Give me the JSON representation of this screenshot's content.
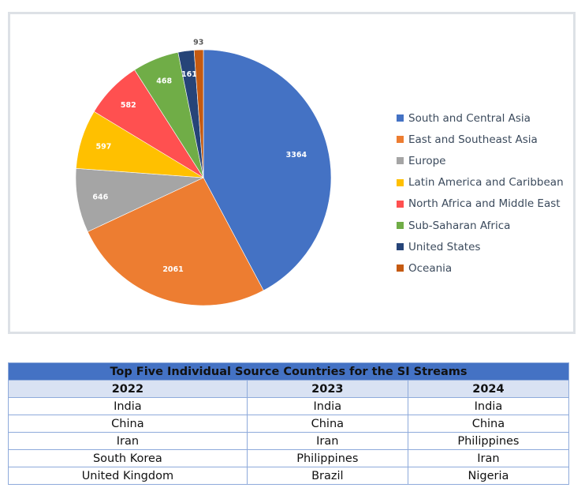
{
  "chart_data": {
    "type": "pie",
    "slices": [
      {
        "label": "South and Central Asia",
        "value": 3364,
        "color": "#4472c4"
      },
      {
        "label": "East and Southeast Asia",
        "value": 2061,
        "color": "#ed7d31"
      },
      {
        "label": "Europe",
        "value": 646,
        "color": "#a5a5a5"
      },
      {
        "label": "Latin America and Caribbean",
        "value": 597,
        "color": "#ffc000"
      },
      {
        "label": "North Africa and Middle East",
        "value": 582,
        "color": "#ff5050"
      },
      {
        "label": "Sub-Saharan Africa",
        "value": 468,
        "color": "#70ad47"
      },
      {
        "label": "United States",
        "value": 161,
        "color": "#264478"
      },
      {
        "label": "Oceania",
        "value": 93,
        "color": "#c55a11"
      }
    ],
    "legend_position": "right"
  },
  "table": {
    "title": "Top Five Individual Source Countries for the SI Streams",
    "headers": [
      "2022",
      "2023",
      "2024"
    ],
    "rows": [
      [
        "India",
        "India",
        "India"
      ],
      [
        "China",
        "China",
        "China"
      ],
      [
        "Iran",
        "Iran",
        "Philippines"
      ],
      [
        "South Korea",
        "Philippines",
        "Iran"
      ],
      [
        "United Kingdom",
        "Brazil",
        "Nigeria"
      ]
    ]
  }
}
